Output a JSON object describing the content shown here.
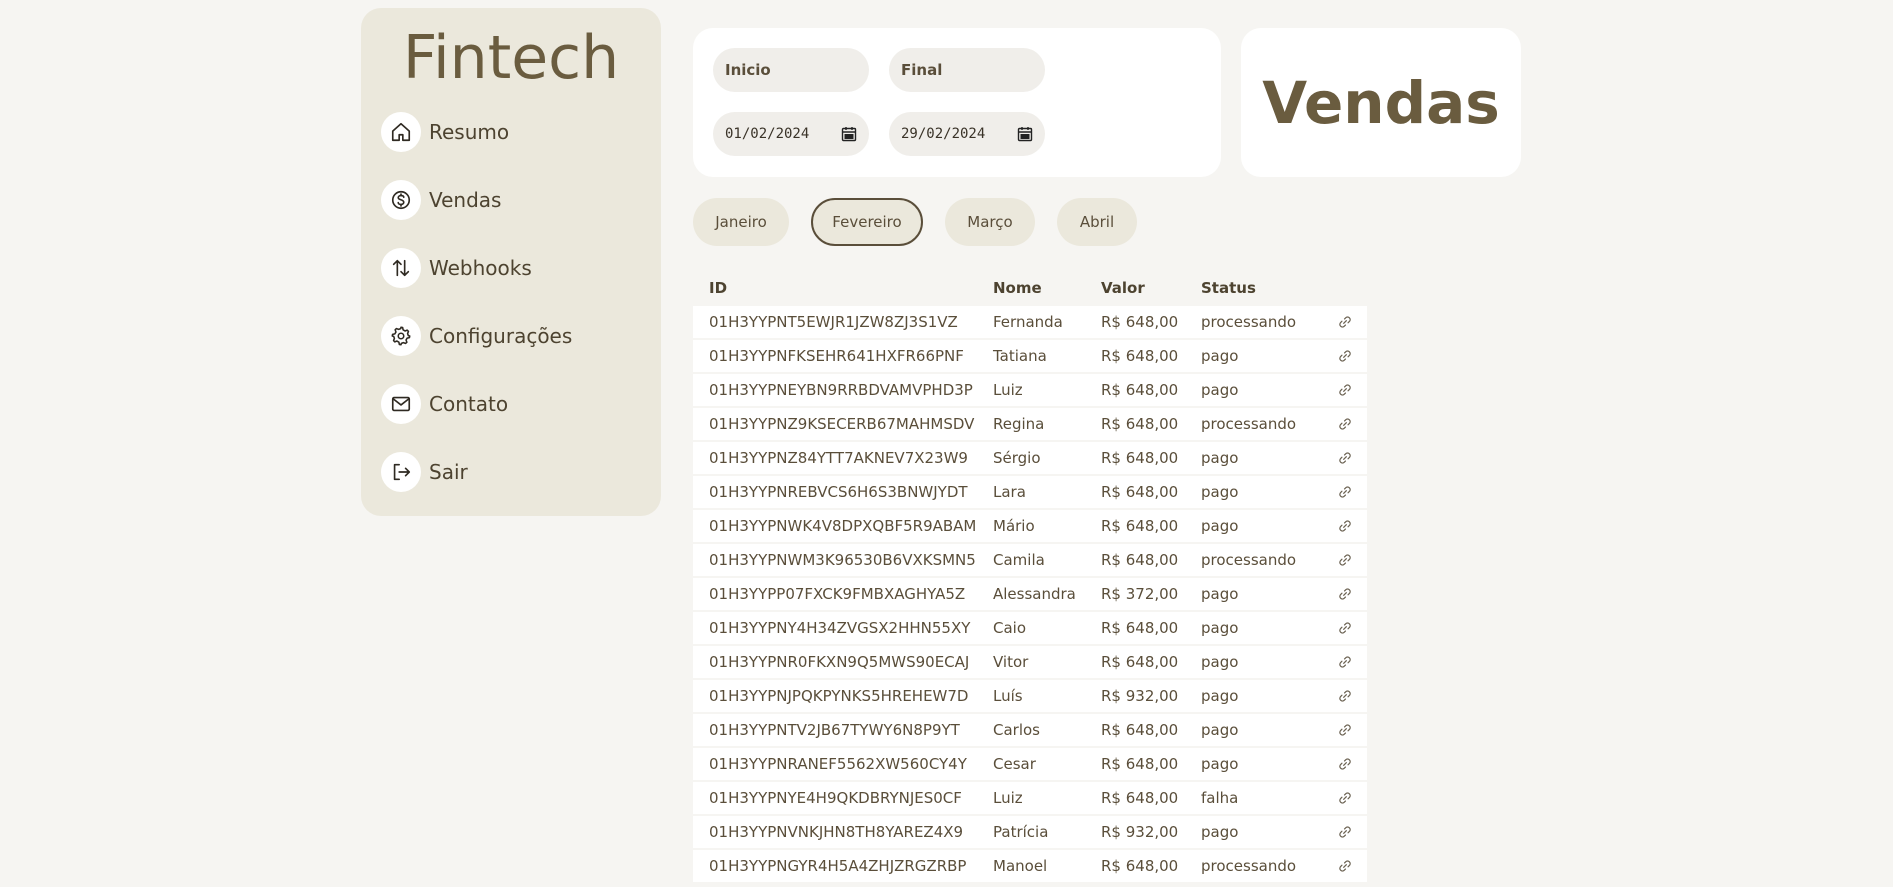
{
  "sidebar": {
    "brand": "Fintech",
    "items": [
      {
        "label": "Resumo",
        "icon": "home-icon"
      },
      {
        "label": "Vendas",
        "icon": "dollar-icon"
      },
      {
        "label": "Webhooks",
        "icon": "arrows-updown-icon"
      },
      {
        "label": "Configurações",
        "icon": "gear-icon"
      },
      {
        "label": "Contato",
        "icon": "mail-icon"
      },
      {
        "label": "Sair",
        "icon": "logout-icon"
      }
    ]
  },
  "filters": {
    "start_label": "Inicio",
    "end_label": "Final",
    "start_value": "01/02/2024",
    "end_value": "29/02/2024"
  },
  "header": {
    "title": "Vendas"
  },
  "months": {
    "items": [
      "Janeiro",
      "Fevereiro",
      "Março",
      "Abril"
    ],
    "active": "Fevereiro"
  },
  "table": {
    "columns": [
      "ID",
      "Nome",
      "Valor",
      "Status"
    ],
    "rows": [
      [
        "01H3YYPNT5EWJR1JZW8ZJ3S1VZ",
        "Fernanda",
        "R$ 648,00",
        "processando"
      ],
      [
        "01H3YYPNFKSEHR641HXFR66PNF",
        "Tatiana",
        "R$ 648,00",
        "pago"
      ],
      [
        "01H3YYPNEYBN9RRBDVAMVPHD3P",
        "Luiz",
        "R$ 648,00",
        "pago"
      ],
      [
        "01H3YYPNZ9KSECERB67MAHMSDV",
        "Regina",
        "R$ 648,00",
        "processando"
      ],
      [
        "01H3YYPNZ84YTT7AKNEV7X23W9",
        "Sérgio",
        "R$ 648,00",
        "pago"
      ],
      [
        "01H3YYPNREBVCS6H6S3BNWJYDT",
        "Lara",
        "R$ 648,00",
        "pago"
      ],
      [
        "01H3YYPNWK4V8DPXQBF5R9ABAM",
        "Mário",
        "R$ 648,00",
        "pago"
      ],
      [
        "01H3YYPNWM3K96530B6VXKSMN5",
        "Camila",
        "R$ 648,00",
        "processando"
      ],
      [
        "01H3YYPP07FXCK9FMBXAGHYA5Z",
        "Alessandra",
        "R$ 372,00",
        "pago"
      ],
      [
        "01H3YYPNY4H34ZVGSX2HHN55XY",
        "Caio",
        "R$ 648,00",
        "pago"
      ],
      [
        "01H3YYPNR0FKXN9Q5MWS90ECAJ",
        "Vitor",
        "R$ 648,00",
        "pago"
      ],
      [
        "01H3YYPNJPQKPYNKS5HREHEW7D",
        "Luís",
        "R$ 932,00",
        "pago"
      ],
      [
        "01H3YYPNTV2JB67TYWY6N8P9YT",
        "Carlos",
        "R$ 648,00",
        "pago"
      ],
      [
        "01H3YYPNRANEF5562XW560CY4Y",
        "Cesar",
        "R$ 648,00",
        "pago"
      ],
      [
        "01H3YYPNYE4H9QKDBRYNJES0CF",
        "Luiz",
        "R$ 648,00",
        "falha"
      ],
      [
        "01H3YYPNVNKJHN8TH8YAREZ4X9",
        "Patrícia",
        "R$ 932,00",
        "pago"
      ],
      [
        "01H3YYPNGYR4H5A4ZHJZRGZRBP",
        "Manoel",
        "R$ 648,00",
        "processando"
      ]
    ]
  }
}
